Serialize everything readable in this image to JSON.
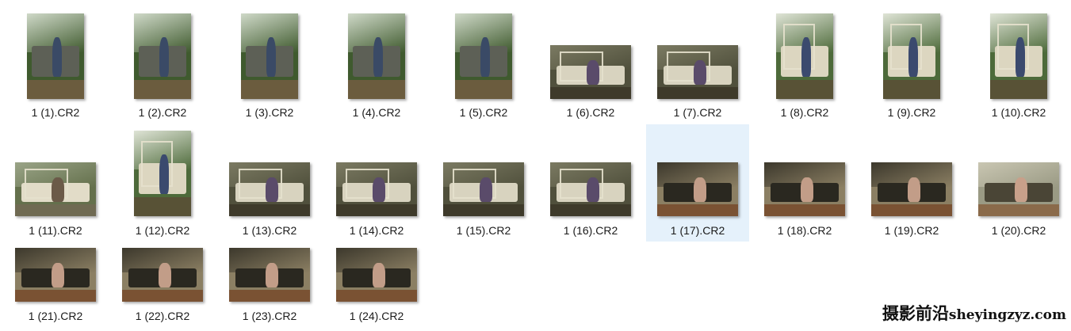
{
  "files": [
    {
      "name": "1 (1).CR2",
      "orientation": "portrait",
      "scene": "outdoor"
    },
    {
      "name": "1 (2).CR2",
      "orientation": "portrait",
      "scene": "outdoor"
    },
    {
      "name": "1 (3).CR2",
      "orientation": "portrait",
      "scene": "outdoor"
    },
    {
      "name": "1 (4).CR2",
      "orientation": "portrait",
      "scene": "outdoor"
    },
    {
      "name": "1 (5).CR2",
      "orientation": "portrait",
      "scene": "outdoor"
    },
    {
      "name": "1 (6).CR2",
      "orientation": "landscape",
      "scene": "window"
    },
    {
      "name": "1 (7).CR2",
      "orientation": "landscape",
      "scene": "window"
    },
    {
      "name": "1 (8).CR2",
      "orientation": "portrait",
      "scene": "door"
    },
    {
      "name": "1 (9).CR2",
      "orientation": "portrait",
      "scene": "door"
    },
    {
      "name": "1 (10).CR2",
      "orientation": "portrait",
      "scene": "door"
    },
    {
      "name": "1 (11).CR2",
      "orientation": "landscape",
      "scene": "car-side"
    },
    {
      "name": "1 (12).CR2",
      "orientation": "portrait",
      "scene": "door"
    },
    {
      "name": "1 (13).CR2",
      "orientation": "landscape",
      "scene": "window"
    },
    {
      "name": "1 (14).CR2",
      "orientation": "landscape",
      "scene": "window"
    },
    {
      "name": "1 (15).CR2",
      "orientation": "landscape",
      "scene": "window"
    },
    {
      "name": "1 (16).CR2",
      "orientation": "landscape",
      "scene": "window"
    },
    {
      "name": "1 (17).CR2",
      "orientation": "landscape",
      "scene": "interior",
      "selected": true
    },
    {
      "name": "1 (18).CR2",
      "orientation": "landscape",
      "scene": "interior"
    },
    {
      "name": "1 (19).CR2",
      "orientation": "landscape",
      "scene": "interior"
    },
    {
      "name": "1 (20).CR2",
      "orientation": "landscape",
      "scene": "interior-light"
    },
    {
      "name": "1 (21).CR2",
      "orientation": "landscape",
      "scene": "interior"
    },
    {
      "name": "1 (22).CR2",
      "orientation": "landscape",
      "scene": "interior"
    },
    {
      "name": "1 (23).CR2",
      "orientation": "landscape",
      "scene": "interior"
    },
    {
      "name": "1 (24).CR2",
      "orientation": "landscape",
      "scene": "interior"
    }
  ],
  "watermark": {
    "cn": "摄影前沿",
    "en": "sheyingzyz.com"
  },
  "colors": {
    "selection": "#e5f1fb",
    "caption": "#1a1a1a"
  }
}
